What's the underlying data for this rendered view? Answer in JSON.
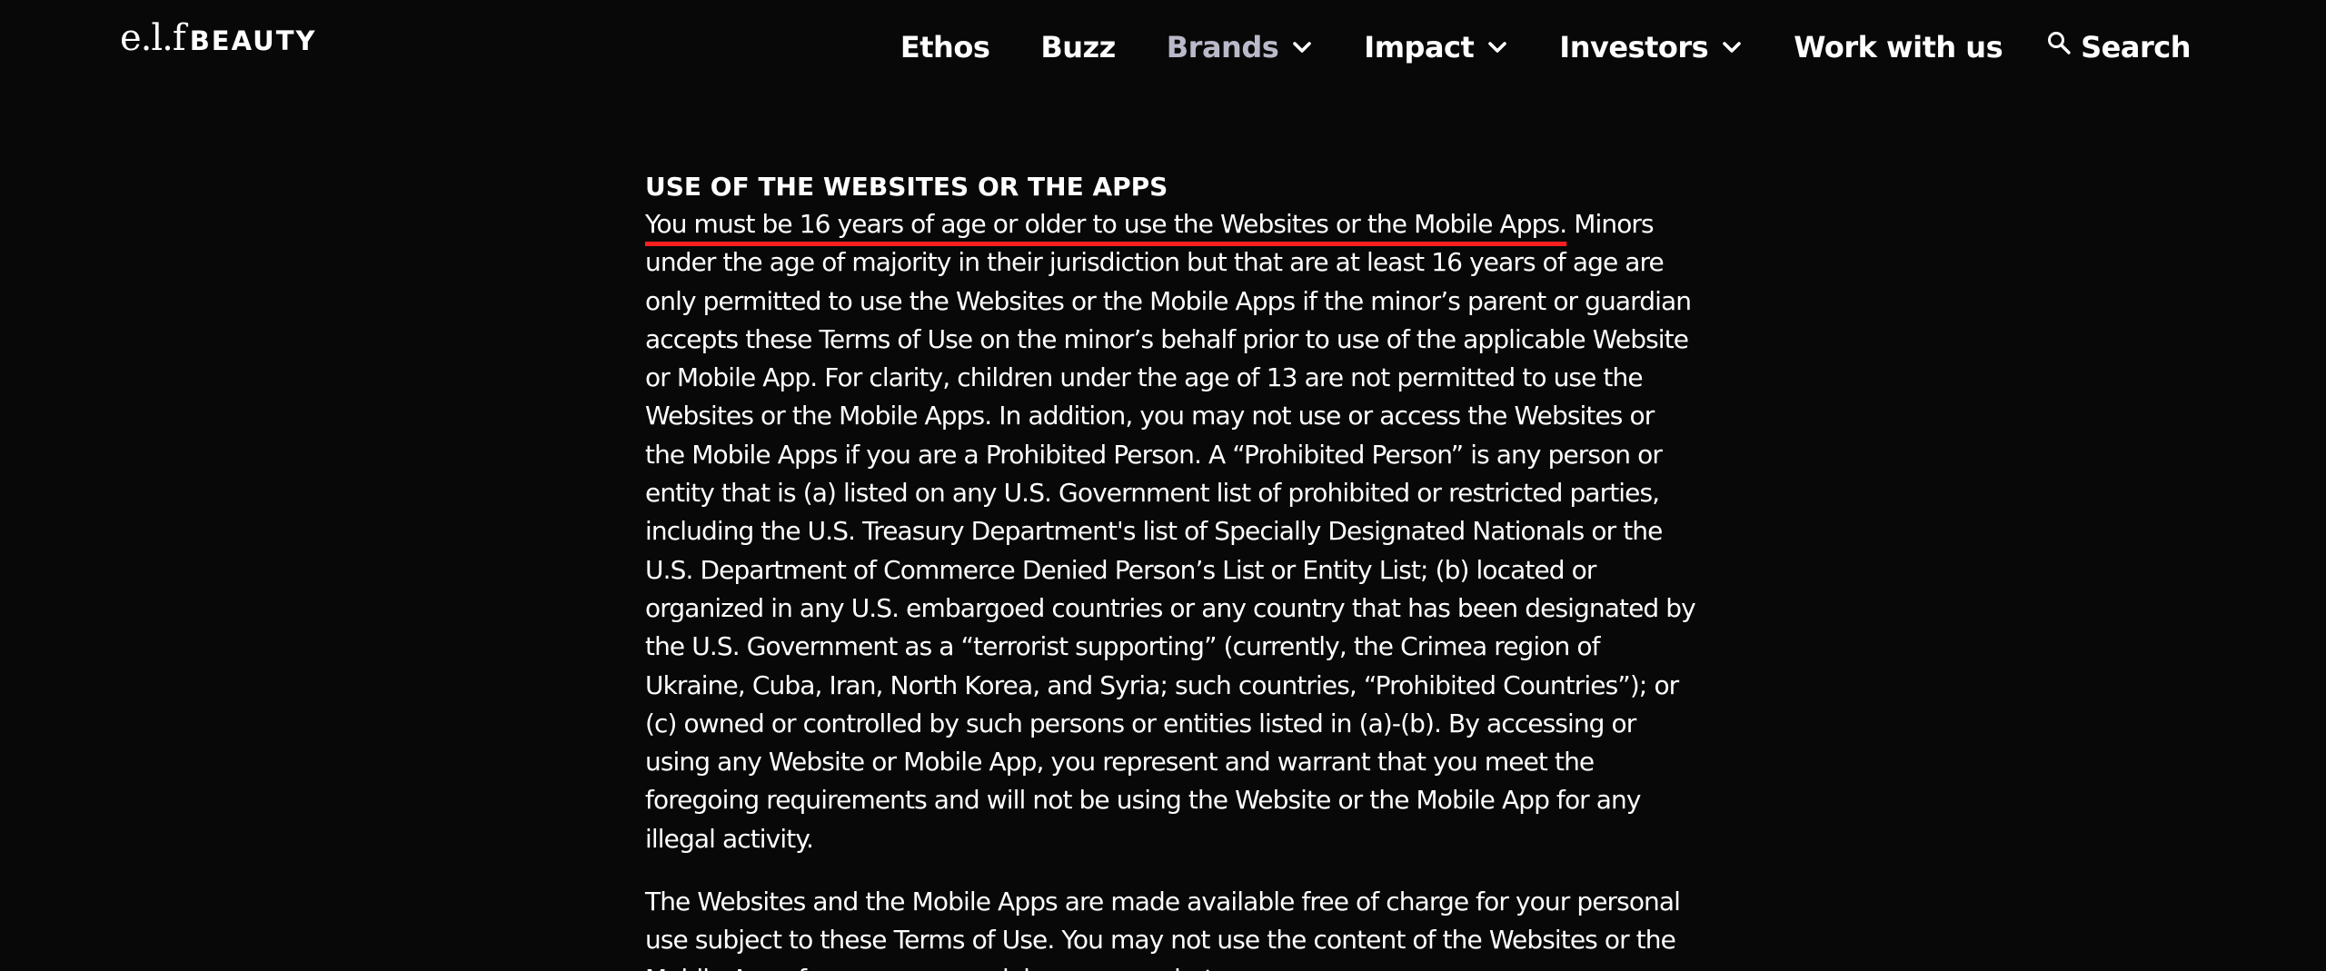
{
  "brand": {
    "logo_script": "e.l.f",
    "logo_word": "BEAUTY"
  },
  "nav": {
    "items": [
      {
        "label": "Ethos",
        "has_dropdown": false,
        "active": false
      },
      {
        "label": "Buzz",
        "has_dropdown": false,
        "active": false
      },
      {
        "label": "Brands",
        "has_dropdown": true,
        "active": true
      },
      {
        "label": "Impact",
        "has_dropdown": true,
        "active": false
      },
      {
        "label": "Investors",
        "has_dropdown": true,
        "active": false
      },
      {
        "label": "Work with us",
        "has_dropdown": false,
        "active": false
      }
    ],
    "search_label": "Search"
  },
  "section": {
    "heading": "USE OF THE WEBSITES OR THE APPS",
    "highlighted_sentence": "You must be 16 years of age or older to use the Websites or the Mobile Apps.",
    "paragraph1_rest": " Minors under the age of majority in their jurisdiction but that are at least 16 years of age are only permitted to use the Websites or the Mobile Apps if the minor’s parent or guardian accepts these Terms of Use on the minor’s behalf prior to use of the applicable Website or Mobile App. For clarity, children under the age of 13 are not permitted to use the Websites or the Mobile Apps. In addition, you may not use or access the Websites or the Mobile Apps if you are a Prohibited Person. A “Prohibited Person” is any person or entity that is (a) listed on any U.S. Government list of prohibited or restricted parties, including the U.S. Treasury Department's list of Specially Designated Nationals or the U.S. Department of Commerce Denied Person’s List or Entity List; (b) located or organized in any U.S. embargoed countries or any country that has been designated by the U.S. Government as a “terrorist supporting” (currently, the Crimea region of Ukraine, Cuba, Iran, North Korea, and Syria; such countries, “Prohibited Countries”); or (c) owned or controlled by such persons or entities listed in (a)-(b). By accessing or using any Website or Mobile App, you represent and warrant that you meet the foregoing requirements and will not be using the Website or the Mobile App for any illegal activity.",
    "paragraph2": "The Websites and the Mobile Apps are made available free of charge for your personal use subject to these Terms of Use. You may not use the content of the Websites or the Mobile Apps for any commercial purposes whatsoever."
  },
  "colors": {
    "background": "#080808",
    "text": "#ffffff",
    "nav_active": "#b9b9c9",
    "highlight_underline": "#ff1f1f"
  },
  "icons": {
    "dropdown": "chevron-down-icon",
    "search": "search-icon"
  }
}
